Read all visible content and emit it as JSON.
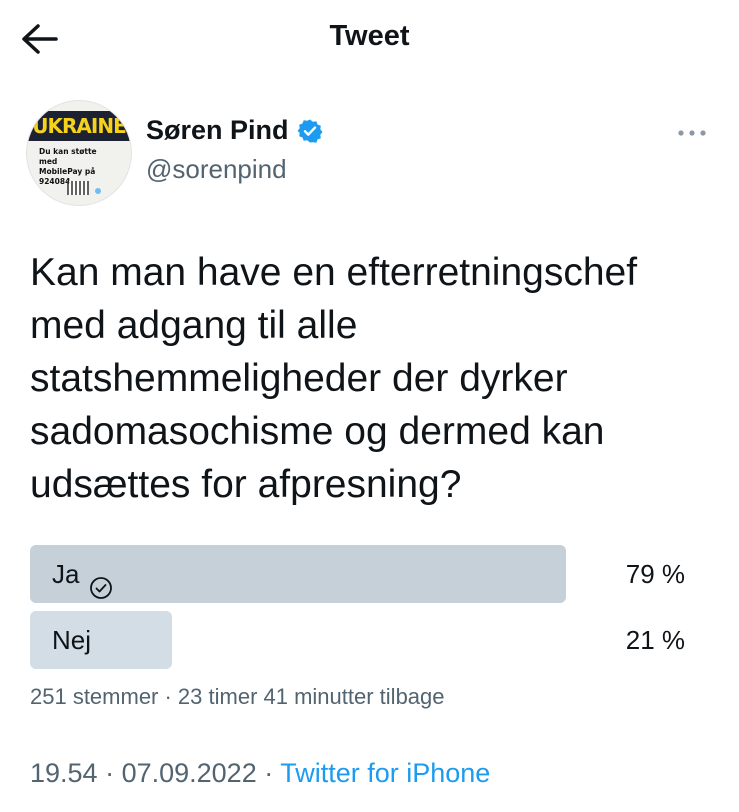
{
  "header": {
    "title": "Tweet"
  },
  "author": {
    "name": "Søren Pind",
    "handle": "@sorenpind",
    "avatar": {
      "banner_text": "UKRAINE",
      "line1": "Du kan støtte med",
      "line2": "MobilePay på",
      "line3": "924084"
    }
  },
  "tweet": {
    "text": "Kan man have en efterretningschef\nmed adgang til alle\nstatshemmeligheder der dyrker\nsadomasochisme og dermed kan\nudsættes for afpresning?"
  },
  "poll": {
    "options": [
      {
        "label": "Ja",
        "percent_label": "79 %",
        "percent": 79,
        "winner": true
      },
      {
        "label": "Nej",
        "percent_label": "21 %",
        "percent": 21,
        "winner": false
      }
    ],
    "meta": "251 stemmer · 23 timer 41 minutter tilbage"
  },
  "footer": {
    "time": "19.54",
    "separator1": " · ",
    "date": "07.09.2022",
    "separator2": " · ",
    "source": "Twitter for iPhone"
  },
  "colors": {
    "winner_bar": "#c5d0d9",
    "other_bar": "#d3dde5",
    "verified": "#1d9bf0",
    "link": "#1d9bf0",
    "muted": "#536471"
  },
  "icons": {
    "back": "arrow-left-icon",
    "verified": "verified-badge-icon",
    "more": "more-dots-icon",
    "check": "check-circle-icon"
  }
}
